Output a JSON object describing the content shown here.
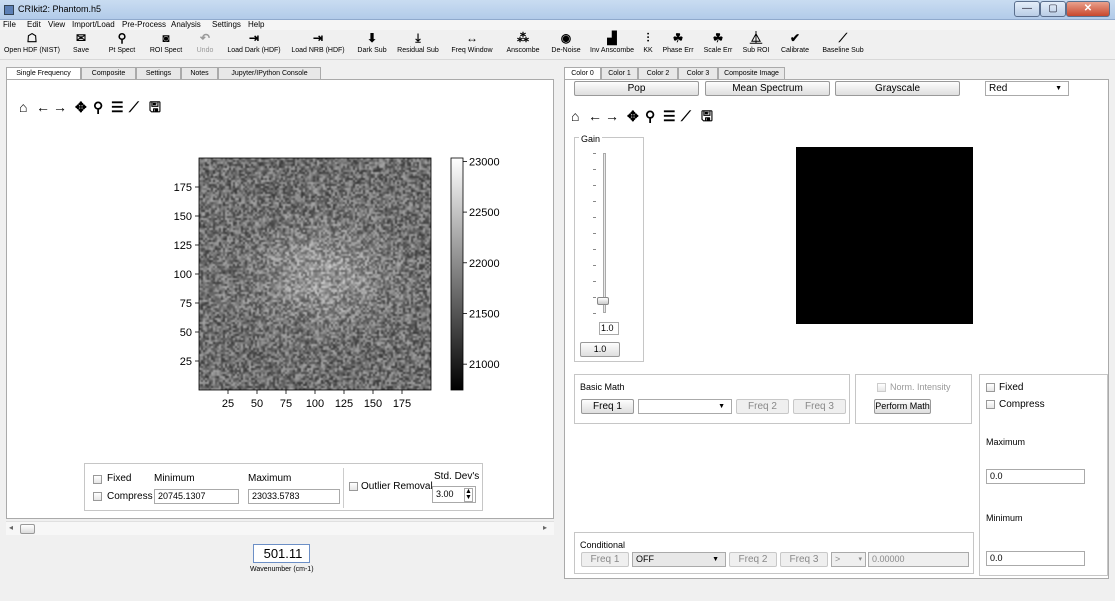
{
  "window": {
    "title": "CRIkit2: Phantom.h5"
  },
  "menus": [
    "File",
    "Edit",
    "View",
    "Import/Load",
    "Pre-Process",
    "Analysis",
    "Settings",
    "Help"
  ],
  "toolbar": [
    {
      "label": "Open HDF (NIST)",
      "icon": "open-icon",
      "glyph": "☖"
    },
    {
      "label": "Save",
      "icon": "envelope-icon",
      "glyph": "✉"
    },
    {
      "label": "Pt Spect",
      "icon": "pin-icon",
      "glyph": "⚲"
    },
    {
      "label": "ROI Spect",
      "icon": "roi-icon",
      "glyph": "◙"
    },
    {
      "label": "Undo",
      "icon": "undo-icon",
      "glyph": "↶"
    },
    {
      "label": "Load Dark (HDF)",
      "icon": "load-dark-icon",
      "glyph": "⇥"
    },
    {
      "label": "Load NRB (HDF)",
      "icon": "load-nrb-icon",
      "glyph": "⇥"
    },
    {
      "label": "Dark Sub",
      "icon": "arrow-down-icon",
      "glyph": "⬇"
    },
    {
      "label": "Residual Sub",
      "icon": "arrow-down-bar-icon",
      "glyph": "⤓"
    },
    {
      "label": "Freq Window",
      "icon": "freq-window-icon",
      "glyph": "↔"
    },
    {
      "label": "Anscombe",
      "icon": "anscombe-icon",
      "glyph": "⁂"
    },
    {
      "label": "De-Noise",
      "icon": "denoise-icon",
      "glyph": "◉"
    },
    {
      "label": "Inv Anscombe",
      "icon": "inv-anscombe-icon",
      "glyph": "▟"
    },
    {
      "label": "KK",
      "icon": "kk-icon",
      "glyph": "⫶"
    },
    {
      "label": "Phase Err",
      "icon": "bug-icon",
      "glyph": "☘"
    },
    {
      "label": "Scale Err",
      "icon": "bug-icon-2",
      "glyph": "☘"
    },
    {
      "label": "Sub ROI",
      "icon": "sub-roi-icon",
      "glyph": "⏅"
    },
    {
      "label": "Calibrate",
      "icon": "check-icon",
      "glyph": "✔"
    },
    {
      "label": "Baseline Sub",
      "icon": "baseline-icon",
      "glyph": "⟋"
    }
  ],
  "left_tabs": [
    "Single Frequency",
    "Composite",
    "Settings",
    "Notes",
    "Jupyter/IPython Console"
  ],
  "right_tabs": [
    "Color 0",
    "Color 1",
    "Color 2",
    "Color 3",
    "Composite Image"
  ],
  "mpl_toolbar": [
    "⌂",
    "←",
    "→",
    "✥",
    "⚲",
    "☰",
    "⟋",
    "🖫"
  ],
  "chart_data": {
    "type": "heatmap",
    "x_ticks": [
      "25",
      "50",
      "75",
      "100",
      "125",
      "150",
      "175"
    ],
    "y_ticks": [
      "175",
      "150",
      "125",
      "100",
      "75",
      "50",
      "25"
    ],
    "colorbar_ticks": [
      "23000",
      "22500",
      "22000",
      "21500",
      "21000"
    ],
    "colormap": "gray",
    "colorbar_range": [
      20745.1307,
      23033.5783
    ]
  },
  "left_controls": {
    "fixed_label": "Fixed",
    "compress_label": "Compress",
    "minimum_label": "Minimum",
    "maximum_label": "Maximum",
    "minimum_value": "20745.1307",
    "maximum_value": "23033.5783",
    "outlier_label": "Outlier Removal",
    "stddev_label": "Std. Dev's",
    "stddev_value": "3.00"
  },
  "wavenumber": {
    "value": "501.11",
    "label": "Wavenumber (cm-1)"
  },
  "color_controls": {
    "pop": "Pop",
    "mean_spectrum": "Mean Spectrum",
    "grayscale": "Grayscale",
    "color_select": "Red"
  },
  "gain": {
    "label": "Gain",
    "value": "1.0",
    "button": "1.0",
    "level": 0.05
  },
  "basic_math": {
    "label": "Basic Math",
    "freq1": "Freq 1",
    "op": "",
    "freq2": "Freq 2",
    "freq3": "Freq 3",
    "norm_label": "Norm. Intensity",
    "perform": "Perform Math"
  },
  "right_side": {
    "fixed_label": "Fixed",
    "compress_label": "Compress",
    "maximum_label": "Maximum",
    "maximum_value": "0.0",
    "minimum_label": "Minimum",
    "minimum_value": "0.0"
  },
  "conditional": {
    "label": "Conditional",
    "freq1": "Freq 1",
    "op_select": "OFF",
    "freq2": "Freq 2",
    "freq3": "Freq 3",
    "cmp": ">",
    "value": "0.00000"
  }
}
